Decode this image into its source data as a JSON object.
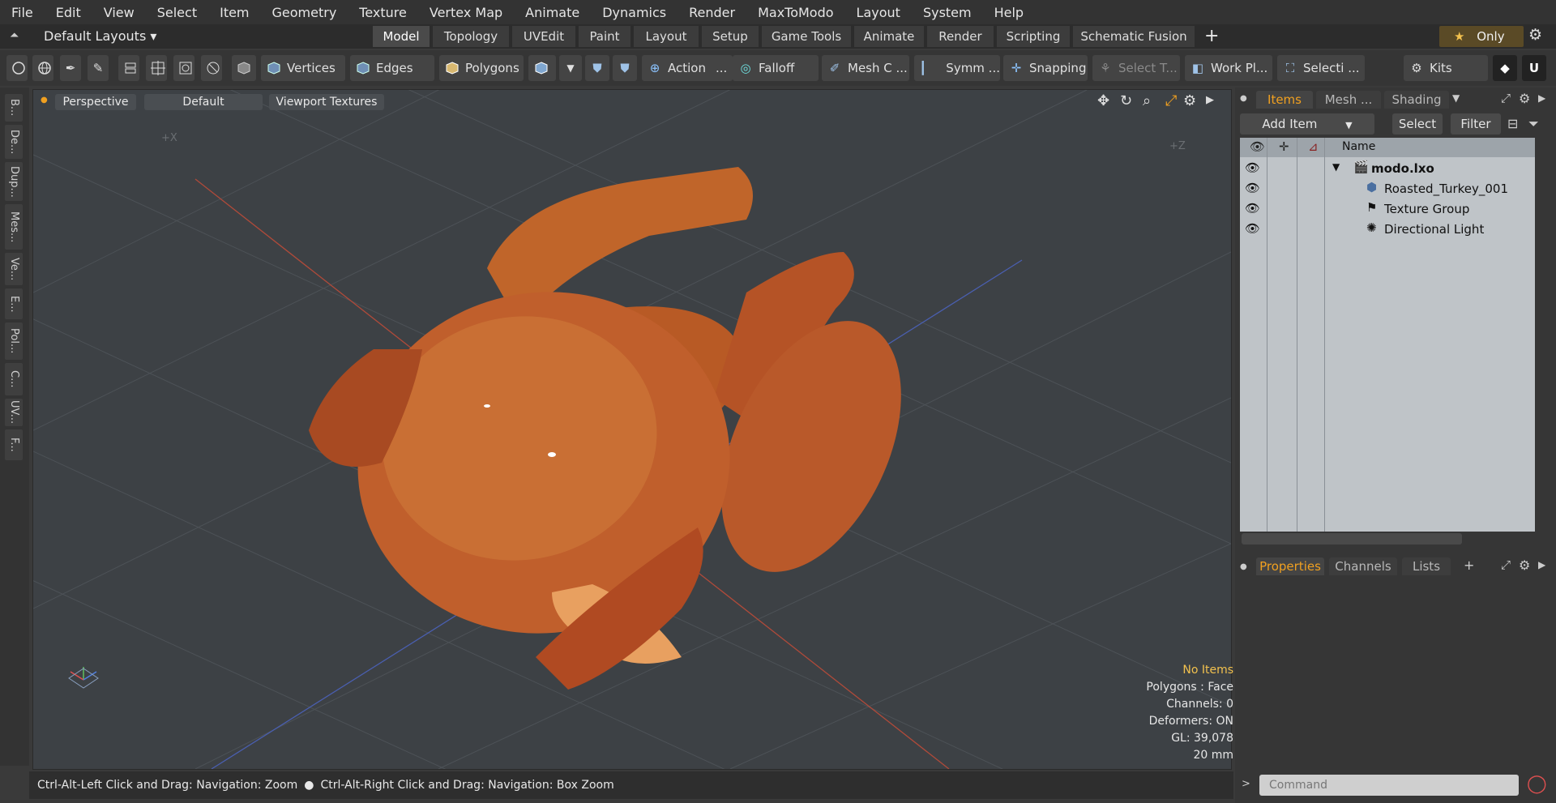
{
  "menu": [
    "File",
    "Edit",
    "View",
    "Select",
    "Item",
    "Geometry",
    "Texture",
    "Vertex Map",
    "Animate",
    "Dynamics",
    "Render",
    "MaxToModo",
    "Layout",
    "System",
    "Help"
  ],
  "layoutbar": {
    "layouts_label": "Default Layouts ▾",
    "tabs": [
      "Model",
      "Topology",
      "UVEdit",
      "Paint",
      "Layout",
      "Setup",
      "Game Tools",
      "Animate",
      "Render",
      "Scripting",
      "Schematic Fusion"
    ],
    "only_label": "Only"
  },
  "toolbar": {
    "vertices": "Vertices",
    "edges": "Edges",
    "polygons": "Polygons",
    "action": "Action",
    "action_more": "...",
    "falloff": "Falloff",
    "mesh": "Mesh C ...",
    "symm": "Symm ...",
    "snapping": "Snapping",
    "select_t": "Select T...",
    "workpl": "Work Pl...",
    "selecti": "Selecti ...",
    "kits": "Kits"
  },
  "left_strip": [
    "B...",
    "De...",
    "Dup...",
    "Mes...",
    "Ve...",
    "E...",
    "Pol...",
    "C...",
    "UV...",
    "F..."
  ],
  "viewport": {
    "perspective": "Perspective",
    "default": "Default",
    "textures": "Viewport Textures",
    "axis_x": "+X",
    "axis_z": "+Z",
    "info": {
      "no_items": "No Items",
      "polygons": "Polygons : Face",
      "channels": "Channels: 0",
      "deformers": "Deformers: ON",
      "gl": "GL: 39,078",
      "scale": "20 mm"
    },
    "colors": {
      "no_items": "#f2c14e",
      "bg": "#3d4145"
    }
  },
  "status": {
    "left": "Ctrl-Alt-Left Click and Drag: Navigation: Zoom",
    "right": "Ctrl-Alt-Right Click and Drag: Navigation: Box Zoom"
  },
  "items_panel": {
    "tabs": [
      "Items",
      "Mesh ...",
      "Shading"
    ],
    "add_item": "Add Item",
    "select": "Select",
    "filter": "Filter",
    "name_header": "Name",
    "rows": [
      "modo.lxo",
      "Roasted_Turkey_001",
      "Texture Group",
      "Directional Light"
    ]
  },
  "props_panel": {
    "tabs": [
      "Properties",
      "Channels",
      "Lists"
    ]
  },
  "command": {
    "placeholder": "Command"
  }
}
